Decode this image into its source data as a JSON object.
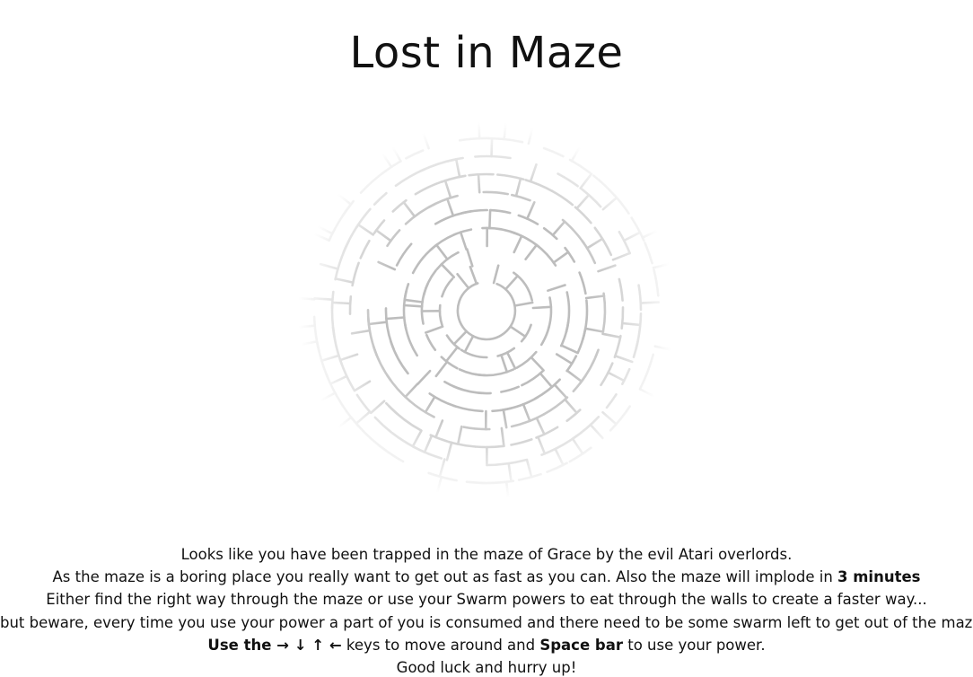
{
  "title": "Lost in Maze",
  "instructions": {
    "line1": "Looks like you have been trapped in the maze of Grace by the evil Atari overlords.",
    "line2_text": "As the maze is a boring place you really want to get out as fast as you can. Also the maze will implode in ",
    "line2_bold": "3 minutes",
    "line3": "Either find the right way through the maze or use your Swarm powers to eat through the walls to create a faster way...",
    "line4": "but beware, every time you use your power a part of you is consumed and there need to be some swarm left to get out of the maze.",
    "line5_bold1": "Use the → ↓ ↑ ←",
    "line5_text1": " keys to move around and ",
    "line5_bold2": "Space bar",
    "line5_text2": " to use your power.",
    "line6": "Good luck and hurry up!"
  },
  "colors": {
    "wall": "#bdbdbd",
    "text": "#111111",
    "background": "#ffffff"
  }
}
